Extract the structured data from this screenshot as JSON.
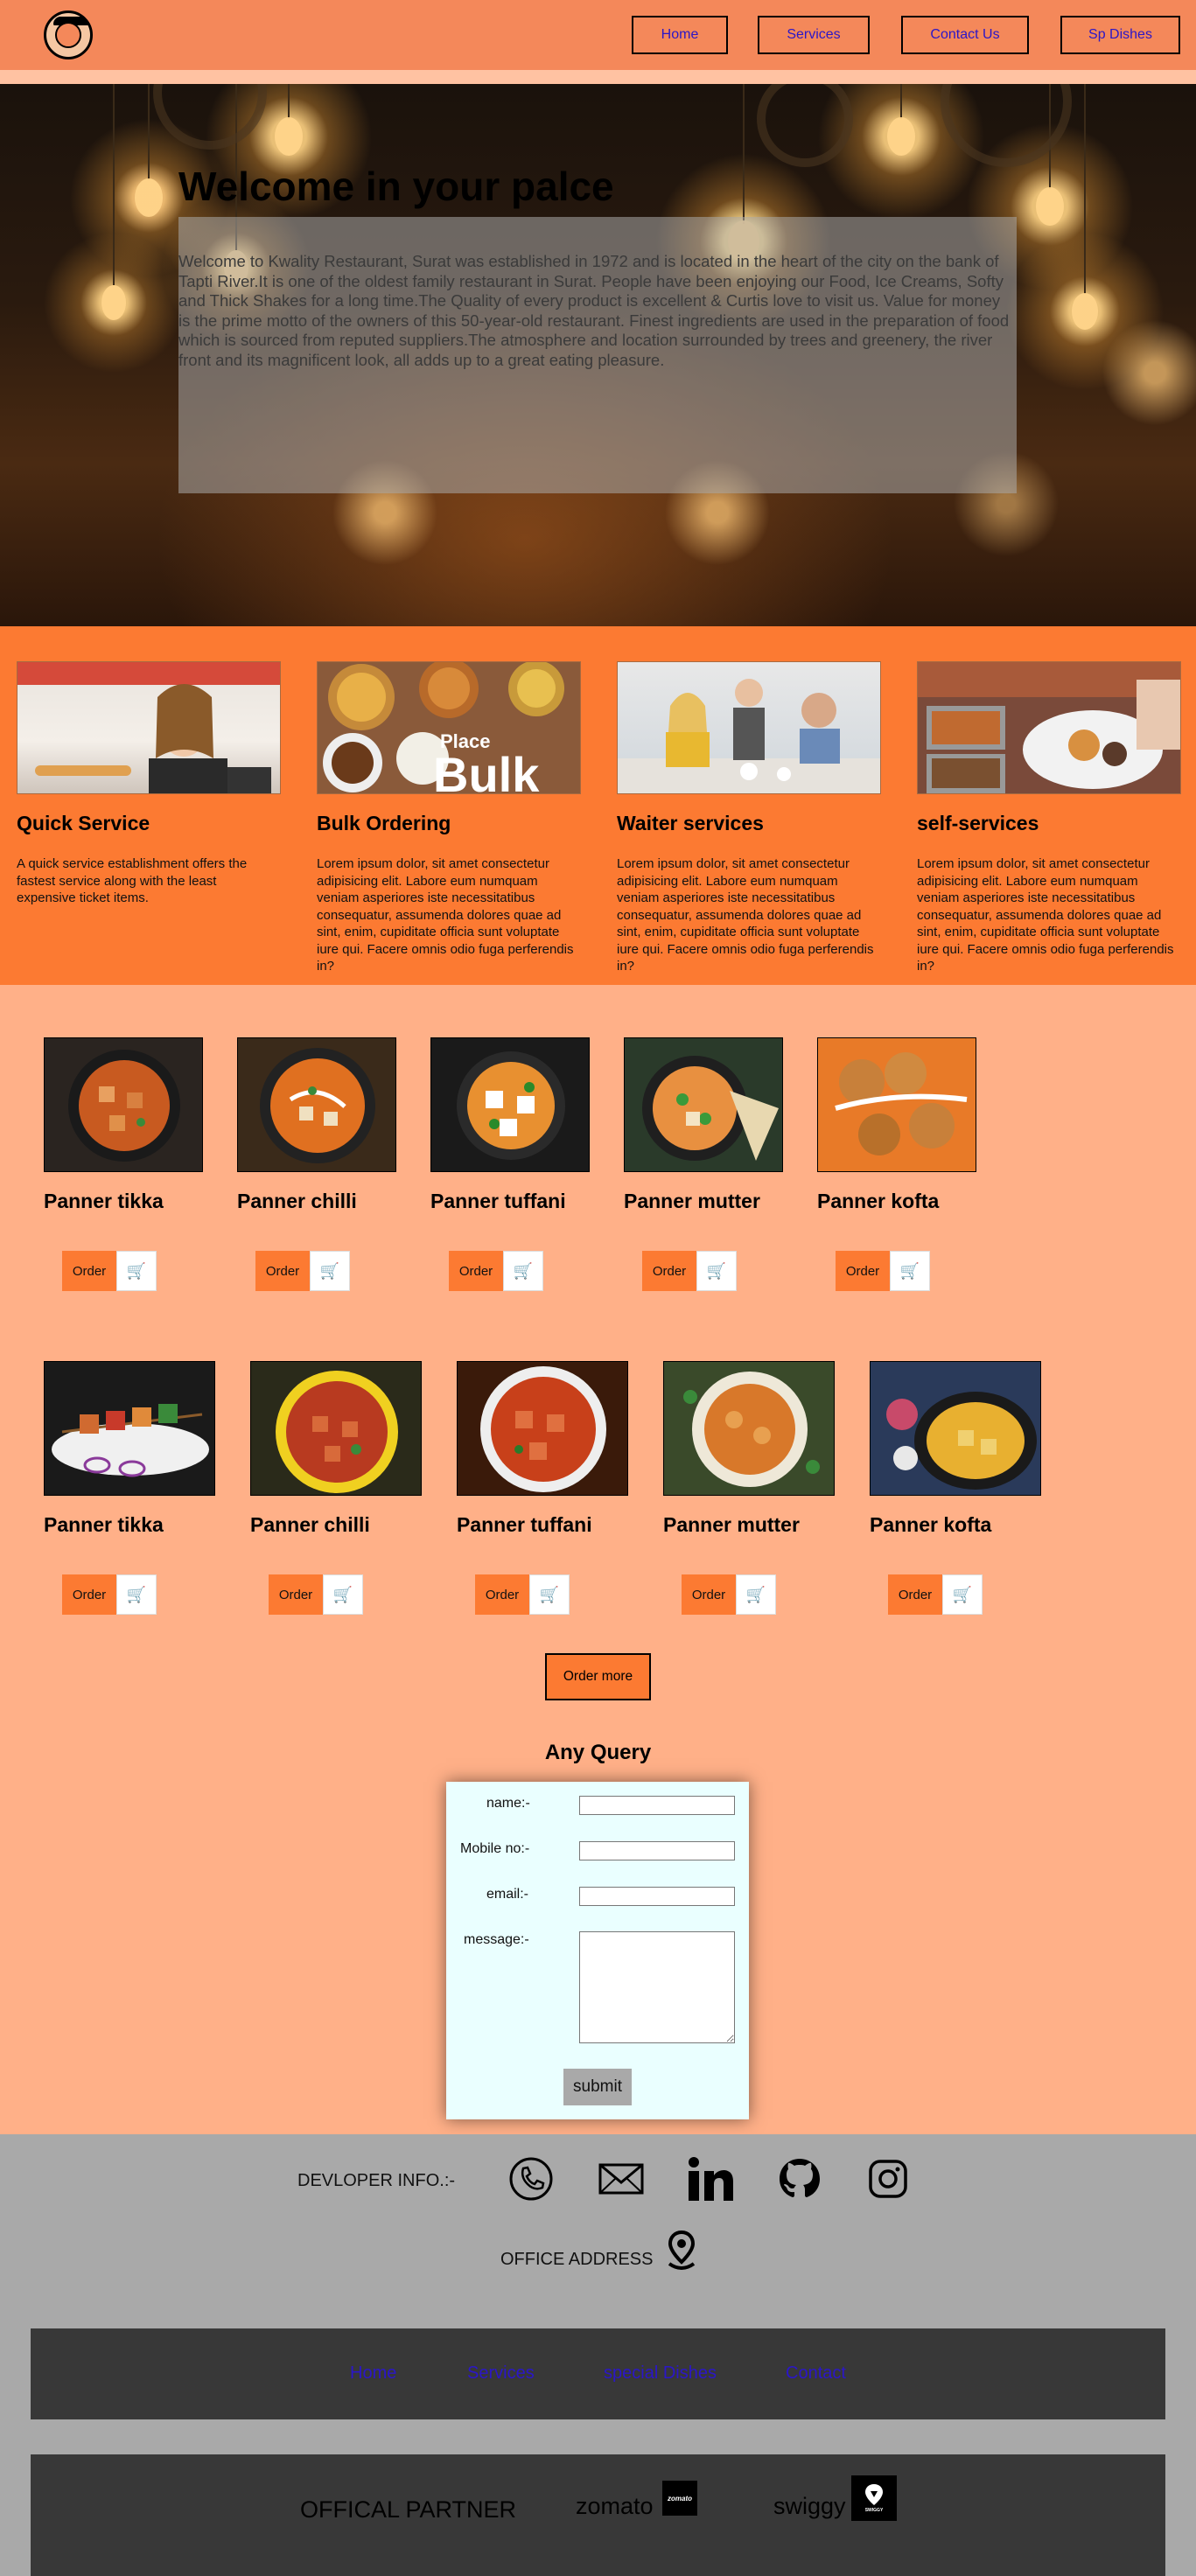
{
  "nav": {
    "items": [
      {
        "label": "Home"
      },
      {
        "label": "Services"
      },
      {
        "label": "Contact Us"
      },
      {
        "label": "Sp Dishes"
      }
    ]
  },
  "hero": {
    "title": "Welcome in your palce",
    "text": "Welcome to Kwality Restaurant, Surat was established in 1972 and is located in the heart of the city on the bank of Tapti River.It is one of the oldest family restaurant in Surat. People have been enjoying our Food, Ice Creams, Softy and Thick Shakes for a long time.The Quality of every product is excellent & Curtis love to visit us. Value for money is the prime motto of the owners of this 50-year-old restaurant. Finest ingredients are used in the preparation of food which is sourced from reputed suppliers.The atmosphere and location surrounded by trees and greenery, the river front and its magnificent look, all adds up to a great eating pleasure."
  },
  "services": [
    {
      "title": "Quick Service",
      "text": "A quick service establishment offers the fastest service along with the least expensive ticket items."
    },
    {
      "title": "Bulk Ordering",
      "text": "Lorem ipsum dolor, sit amet consectetur adipisicing elit. Labore eum numquam veniam asperiores iste necessitatibus consequatur, assumenda dolores quae ad sint, enim, cupiditate officia sunt voluptate iure qui. Facere omnis odio fuga perferendis in?",
      "image_text_1": "Place",
      "image_text_2": "Bulk"
    },
    {
      "title": "Waiter services",
      "text": "Lorem ipsum dolor, sit amet consectetur adipisicing elit. Labore eum numquam veniam asperiores iste necessitatibus consequatur, assumenda dolores quae ad sint, enim, cupiditate officia sunt voluptate iure qui. Facere omnis odio fuga perferendis in?"
    },
    {
      "title": "self-services",
      "text": "Lorem ipsum dolor, sit amet consectetur adipisicing elit. Labore eum numquam veniam asperiores iste necessitatibus consequatur, assumenda dolores quae ad sint, enim, cupiditate officia sunt voluptate iure qui. Facere omnis odio fuga perferendis in?"
    }
  ],
  "menu": {
    "row1": [
      {
        "name": "Panner tikka"
      },
      {
        "name": "Panner chilli"
      },
      {
        "name": "Panner tuffani"
      },
      {
        "name": "Panner mutter"
      },
      {
        "name": "Panner kofta"
      }
    ],
    "row2": [
      {
        "name": "Panner tikka"
      },
      {
        "name": "Panner chilli"
      },
      {
        "name": "Panner tuffani"
      },
      {
        "name": "Panner mutter"
      },
      {
        "name": "Panner kofta"
      }
    ],
    "order_label": "Order",
    "order_more_label": "Order more"
  },
  "query": {
    "title": "Any Query",
    "name_label": "name:-",
    "mobile_label": "Mobile no:-",
    "email_label": "email:-",
    "message_label": "message:-",
    "submit_label": "submit"
  },
  "footer": {
    "developer_label": "DEVLOPER INFO.:-",
    "office_label": "OFFICE ADDRESS",
    "links": [
      {
        "label": "Home"
      },
      {
        "label": "Services"
      },
      {
        "label": "special Dishes"
      },
      {
        "label": "Contact"
      }
    ],
    "partner_label": "OFFICAL PARTNER",
    "partners": [
      {
        "name": "zomato",
        "logo_text": "zomato"
      },
      {
        "name": "swiggy",
        "logo_text": "SWIGGY"
      }
    ]
  },
  "colors": {
    "nav_bg": "#f4885a",
    "page_bg": "#ffb088",
    "services_bg": "#fc7a32",
    "link_blue": "#2b16c8",
    "footer_bg": "#a9a9a9",
    "footer_bar": "#383838",
    "form_bg": "#eaffff"
  }
}
